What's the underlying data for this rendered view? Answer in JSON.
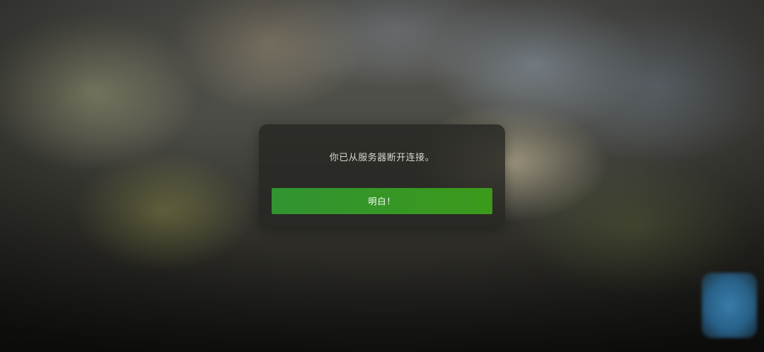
{
  "dialog": {
    "message": "你已从服务器断开连接。",
    "confirm_label": "明白！"
  },
  "colors": {
    "button_green": "#35962a",
    "dialog_background": "#262622",
    "corner_widget_blue": "#3f8fc4"
  }
}
